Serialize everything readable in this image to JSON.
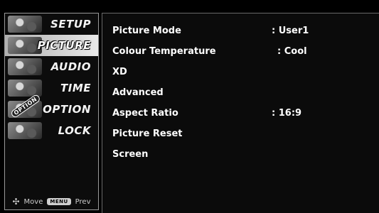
{
  "sidebar": {
    "items": [
      {
        "label": "SETUP",
        "icon": "setup-thumbnail-icon",
        "selected": false
      },
      {
        "label": "PICTURE",
        "icon": "picture-thumbnail-icon",
        "selected": true
      },
      {
        "label": "AUDIO",
        "icon": "audio-thumbnail-icon",
        "selected": false
      },
      {
        "label": "TIME",
        "icon": "time-thumbnail-icon",
        "selected": false
      },
      {
        "label": "OPTION",
        "icon": "option-thumbnail-icon",
        "badge": "OPTION",
        "selected": false
      },
      {
        "label": "LOCK",
        "icon": "lock-thumbnail-icon",
        "selected": false
      }
    ],
    "hint": {
      "move_icon": "dpad-arrows-icon",
      "move_label": "Move",
      "menu_key": "MENU",
      "prev_label": "Prev"
    }
  },
  "main": {
    "items": [
      {
        "label": "Picture Mode",
        "value": ": User1"
      },
      {
        "label": "Colour Temperature",
        "value": ": Cool"
      },
      {
        "label": "XD",
        "value": ""
      },
      {
        "label": "Advanced",
        "value": ""
      },
      {
        "label": "Aspect Ratio",
        "value": ": 16:9"
      },
      {
        "label": "Picture Reset",
        "value": ""
      },
      {
        "label": "Screen",
        "value": ""
      }
    ]
  },
  "colors": {
    "background": "#000000",
    "panel": "#0b0b0b",
    "selected_highlight": "#d9d9d9",
    "text": "#ffffff"
  }
}
